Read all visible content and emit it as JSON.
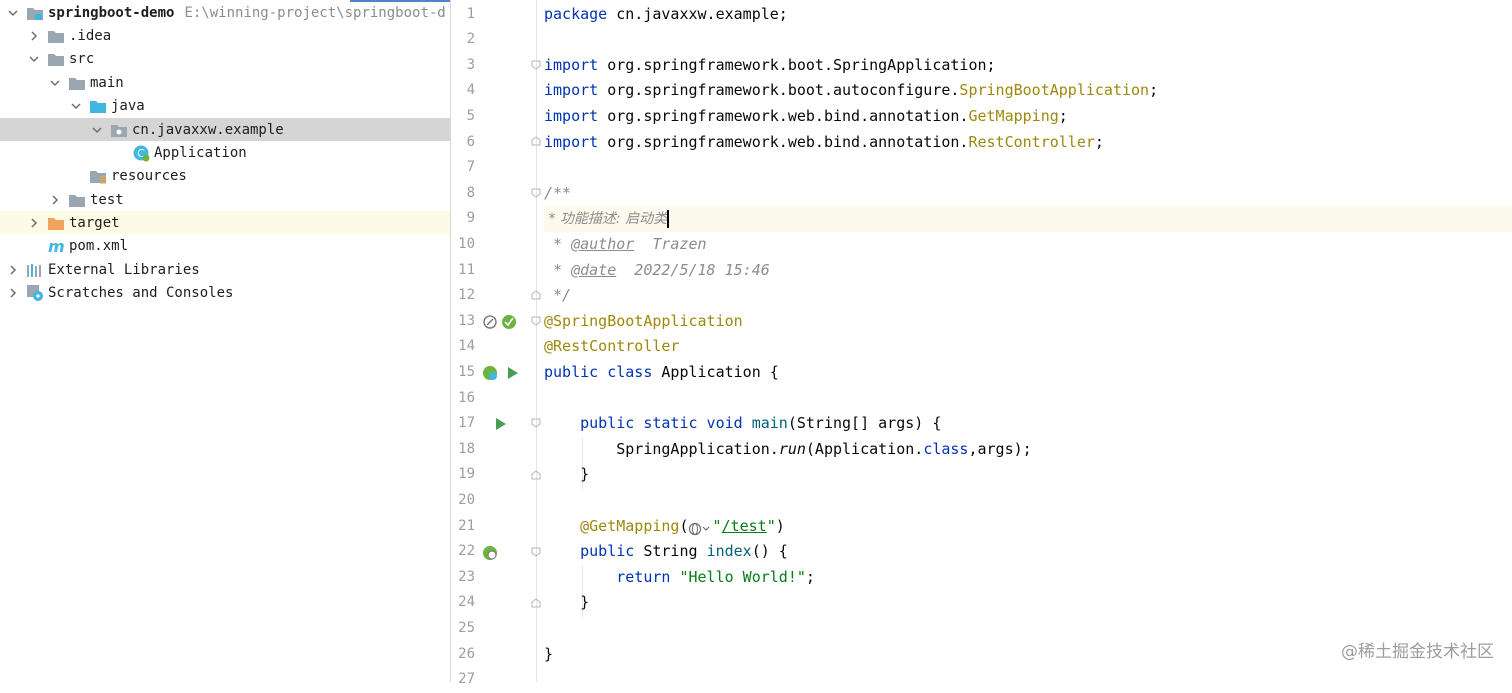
{
  "project": {
    "name": "springboot-demo",
    "path": "E:\\winning-project\\springboot-d",
    "nodes": [
      {
        "label": "springboot-demo",
        "icon": "module-folder-icon",
        "expanded": true
      },
      {
        "label": ".idea",
        "icon": "folder-icon",
        "expanded": false
      },
      {
        "label": "src",
        "icon": "folder-icon",
        "expanded": true
      },
      {
        "label": "main",
        "icon": "folder-icon",
        "expanded": true
      },
      {
        "label": "java",
        "icon": "source-folder-icon",
        "expanded": true
      },
      {
        "label": "cn.javaxxw.example",
        "icon": "package-icon",
        "expanded": true
      },
      {
        "label": "Application",
        "icon": "spring-class-icon"
      },
      {
        "label": "resources",
        "icon": "resources-folder-icon"
      },
      {
        "label": "test",
        "icon": "folder-icon",
        "expanded": false
      },
      {
        "label": "target",
        "icon": "excluded-folder-icon",
        "expanded": false
      },
      {
        "label": "pom.xml",
        "icon": "maven-icon"
      },
      {
        "label": "External Libraries",
        "icon": "libraries-icon",
        "expanded": false
      },
      {
        "label": "Scratches and Consoles",
        "icon": "scratches-icon",
        "expanded": false
      }
    ]
  },
  "editor": {
    "line_numbers": [
      "1",
      "2",
      "3",
      "4",
      "5",
      "6",
      "7",
      "8",
      "9",
      "10",
      "11",
      "12",
      "13",
      "14",
      "15",
      "16",
      "17",
      "18",
      "19",
      "20",
      "21",
      "22",
      "23",
      "24",
      "25",
      "26",
      "27"
    ],
    "code": {
      "l1_kw": "package",
      "l1_rest": " cn.javaxxw.example;",
      "import_kw": "import",
      "l3_rest": " org.springframework.boot.SpringApplication;",
      "l4_pre": " org.springframework.boot.autoconfigure.",
      "l4_ann": "SpringBootApplication",
      "l5_pre": " org.springframework.web.bind.annotation.",
      "l5_ann": "GetMapping",
      "l6_pre": " org.springframework.web.bind.annotation.",
      "l6_ann": "RestController",
      "semi": ";",
      "l8": "/**",
      "l9": " * 功能描述: 启动类",
      "l10_star": " * ",
      "l10_tag": "@author",
      "l10_val": "  Trazen",
      "l11_star": " * ",
      "l11_tag": "@date",
      "l11_val": "  2022/5/18 15:46",
      "l12": " */",
      "l13": "@SpringBootApplication",
      "l14": "@RestController",
      "l15_kw": "public class",
      "l15_rest": " Application {",
      "l17_kw": "    public static void",
      "l17_fn": " main",
      "l17_rest": "(String[] args) {",
      "l18_pre": "        SpringApplication.",
      "l18_run": "run",
      "l18_mid": "(Application.",
      "l18_class": "class",
      "l18_end": ",args);",
      "l19": "    }",
      "l21_ann": "    @GetMapping",
      "l21_open": "(",
      "l21_q1": "\"",
      "l21_path": "/test",
      "l21_q2": "\"",
      "l21_close": ")",
      "l22_kw": "    public",
      "l22_mid": " String ",
      "l22_fn": "index",
      "l22_rest": "() {",
      "l23_kw": "        return",
      "l23_str": " \"Hello World!\"",
      "l23_end": ";",
      "l24": "    }",
      "l26": "}"
    }
  },
  "watermark": "@稀土掘金技术社区"
}
